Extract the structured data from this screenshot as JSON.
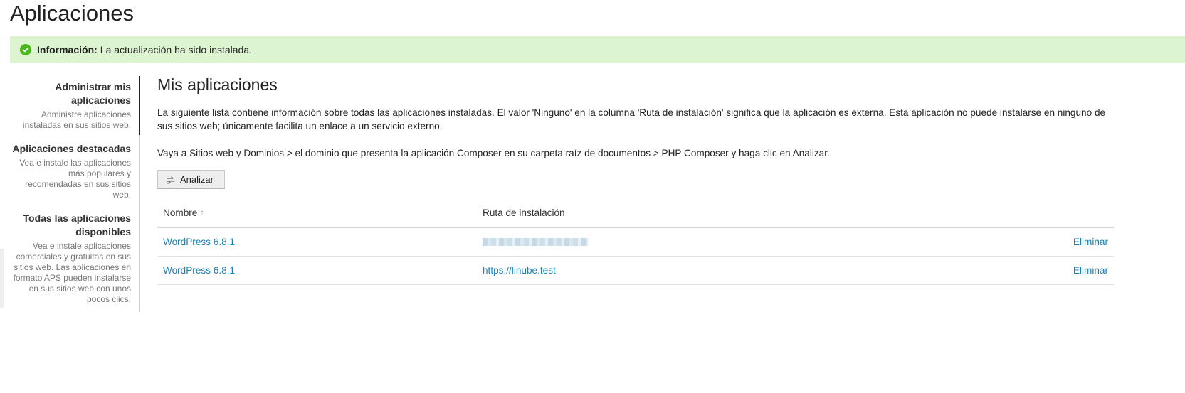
{
  "page": {
    "title": "Aplicaciones"
  },
  "message": {
    "label": "Información:",
    "text": "La actualización ha sido instalada.",
    "color": "#4ab71c",
    "icon": "check-circle-icon"
  },
  "sidebar": {
    "items": [
      {
        "title": "Administrar mis aplicaciones",
        "desc": "Administre aplicaciones instaladas en sus sitios web.",
        "active": true
      },
      {
        "title": "Aplicaciones destacadas",
        "desc": "Vea e instale las aplicaciones más populares y recomendadas en sus sitios web.",
        "active": false
      },
      {
        "title": "Todas las aplicaciones disponibles",
        "desc": "Vea e instale aplicaciones comerciales y gratuitas en sus sitios web. Las aplicaciones en formato APS pueden instalarse en sus sitios web con unos pocos clics.",
        "active": false
      }
    ]
  },
  "main": {
    "title": "Mis aplicaciones",
    "paragraph1": "La siguiente lista contiene información sobre todas las aplicaciones instaladas. El valor 'Ninguno' en la columna 'Ruta de instalación' significa que la aplicación es externa. Esta aplicación no puede instalarse en ninguno de sus sitios web; únicamente facilita un enlace a un servicio externo.",
    "paragraph2": "Vaya a Sitios web y Dominios > el dominio que presenta la aplicación Composer en su carpeta raíz de documentos > PHP Composer y haga clic en Analizar.",
    "analyze_button": {
      "label": "Analizar",
      "icon": "scan-icon"
    }
  },
  "table": {
    "columns": {
      "name": "Nombre",
      "sort_indicator": "↑",
      "path": "Ruta de instalación"
    },
    "rows": [
      {
        "name": "WordPress 6.8.1",
        "path": "",
        "path_blurred": true,
        "action": "Eliminar"
      },
      {
        "name": "WordPress 6.8.1",
        "path": "https://linube.test",
        "path_blurred": false,
        "action": "Eliminar"
      }
    ]
  },
  "colors": {
    "link": "#1a80b6",
    "message_bg": "#dcf5d0"
  }
}
